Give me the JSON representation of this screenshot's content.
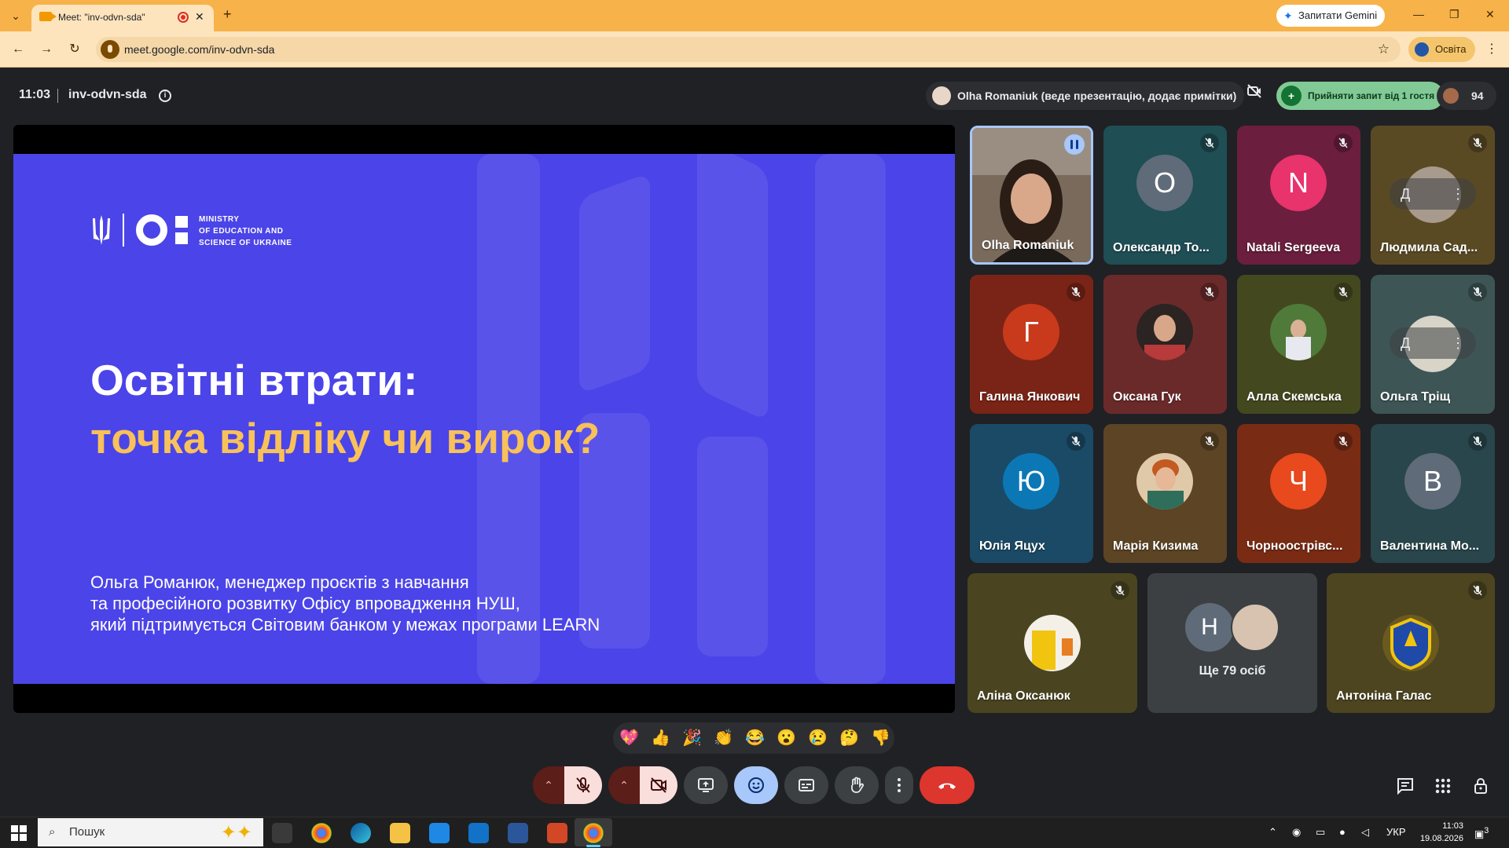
{
  "browser": {
    "tab_title": "Meet: \"inv-odvn-sda\"",
    "new_tab": "+",
    "gemini_label": "Запитати Gemini",
    "url": "meet.google.com/inv-odvn-sda",
    "profile_label": "Освіта",
    "tab_dropdown": "⌄",
    "tab_close": "✕",
    "bookmark": "☆",
    "menu": "⋮",
    "window_controls": [
      "—",
      "❐",
      "✕"
    ]
  },
  "meet": {
    "time": "11:03",
    "code": "inv-odvn-sda",
    "info": "i",
    "presenter_chip": "Olha Romaniuk (веде презентацію, додає примітки)",
    "accept_chip": "Прийняти запит від 1 гостя",
    "people_count": "94"
  },
  "slide": {
    "logo_text_1": "MINISTRY",
    "logo_text_2": "OF EDUCATION AND",
    "logo_text_3": "SCIENCE OF UKRAINE",
    "title_line1": "Освітні втрати:",
    "title_line2": "точка відліку чи вирок?",
    "author_line1": "Ольга Романюк, менеджер проєктів з навчання",
    "author_line2": "та професійного розвитку Офісу впровадження НУШ,",
    "author_line3": "який підтримується Світовим банком у межах програми LEARN"
  },
  "participants": [
    {
      "name": "Olha Romaniuk",
      "kind": "video",
      "speaking": true
    },
    {
      "name": "Олександр То...",
      "kind": "letter",
      "letter": "О",
      "bg": "#1f4e55",
      "avatar": "#5f6b78"
    },
    {
      "name": "Natali Sergeeva",
      "kind": "letter",
      "letter": "N",
      "bg": "#6b1e3e",
      "avatar": "#e8336d"
    },
    {
      "name": "Людмила Сад...",
      "kind": "photo",
      "bg": "#5a4a24",
      "pinned_controls": true,
      "pin_label": "Д",
      "more_label": "⋮"
    },
    {
      "name": "Галина Янкович",
      "kind": "letter",
      "letter": "Г",
      "bg": "#7a2417",
      "avatar": "#c83a1b"
    },
    {
      "name": "Оксана Гук",
      "kind": "photo",
      "bg": "#6b2a2a"
    },
    {
      "name": "Алла Скемська",
      "kind": "photo",
      "bg": "#44481f"
    },
    {
      "name": "Ольга Тріщ",
      "kind": "photo",
      "bg": "#3e5556",
      "pinned_controls": true,
      "pin_label": "Д",
      "more_label": "⋮"
    },
    {
      "name": "Юлія Яцух",
      "kind": "letter",
      "letter": "Ю",
      "bg": "#1b4a66",
      "avatar": "#0b78b5"
    },
    {
      "name": "Марія Кизима",
      "kind": "photo",
      "bg": "#5c4424"
    },
    {
      "name": "Чорноострівс...",
      "kind": "letter",
      "letter": "Ч",
      "bg": "#7a2b14",
      "avatar": "#e8491d"
    },
    {
      "name": "Валентина Мо...",
      "kind": "letter",
      "letter": "В",
      "bg": "#28464b",
      "avatar": "#5f6b78"
    },
    {
      "name": "Аліна Оксанюк",
      "kind": "photo",
      "bg": "#4a4520"
    },
    {
      "name": "Антоніна Галас",
      "kind": "photo",
      "bg": "#4d4520"
    }
  ],
  "more_people": {
    "label": "Ще 79 осіб",
    "letter": "Н"
  },
  "reactions": [
    "💖",
    "👍",
    "🎉",
    "👏",
    "😂",
    "😮",
    "😢",
    "🤔",
    "👎"
  ],
  "controls": {
    "mic_options_arrow": "⌃",
    "camera_options_arrow": "⌃"
  },
  "taskbar": {
    "search_placeholder": "Пошук",
    "search_icon": "⌕",
    "sparkle": "✦✦",
    "lang": "УКР",
    "time": "11:03",
    "date": "19.08.2026",
    "notification_count": "3"
  },
  "colors": {
    "slide_bg": "#4b44e8",
    "slide_accent": "#f8c15a",
    "chrome_accent": "#f7b24a",
    "hangup": "#dc362e",
    "emoji_active": "#a8c7fa"
  }
}
